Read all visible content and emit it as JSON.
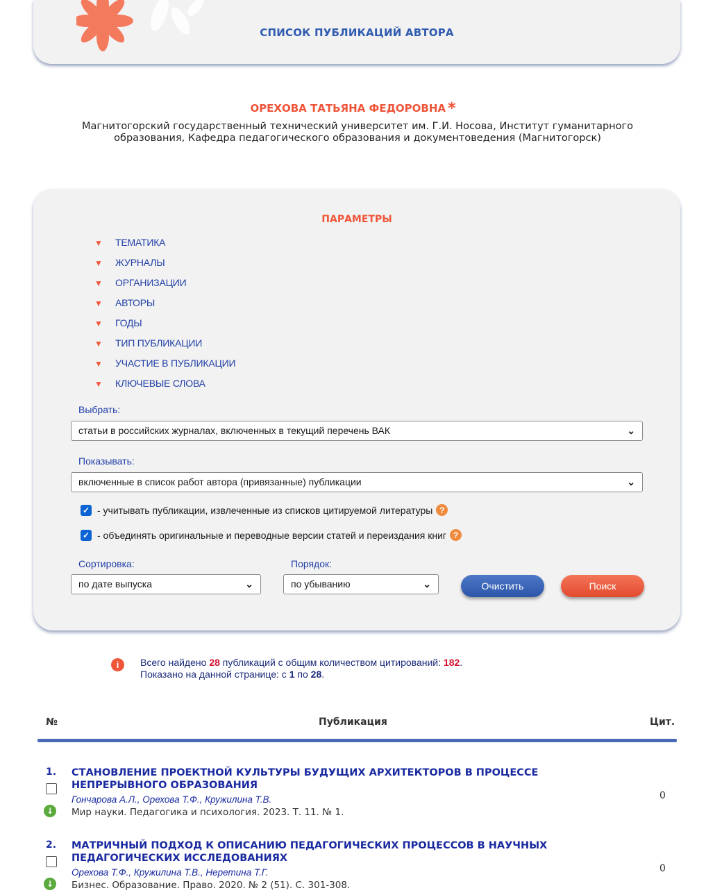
{
  "header": {
    "title": "СПИСОК ПУБЛИКАЦИЙ АВТОРА"
  },
  "author": {
    "name": "ОРЕХОВА ТАТЬЯНА ФЕДОРОВНА",
    "star": "*",
    "affiliation": "Магнитогорский государственный технический университет им. Г.И. Носова, Институт гуманитарного образования, Кафедра педагогического образования и документоведения (Магнитогорск)"
  },
  "params": {
    "title": "ПАРАМЕТРЫ",
    "filters": [
      "ТЕМАТИКА",
      "ЖУРНАЛЫ",
      "ОРГАНИЗАЦИИ",
      "АВТОРЫ",
      "ГОДЫ",
      "ТИП ПУБЛИКАЦИИ",
      "УЧАСТИЕ В ПУБЛИКАЦИИ",
      "КЛЮЧЕВЫЕ СЛОВА"
    ],
    "select_label": "Выбрать:",
    "select_value": "статьи в российских журналах, включенных в текущий перечень ВАК",
    "show_label": "Показывать:",
    "show_value": "включенные в список работ автора (привязанные) публикации",
    "checkbox1": "- учитывать публикации, извлеченные из списков цитируемой литературы",
    "checkbox2": "- объединять оригинальные и переводные версии статей и переиздания книг",
    "sort_label": "Сортировка:",
    "sort_value": "по дате выпуска",
    "order_label": "Порядок:",
    "order_value": "по убыванию",
    "clear_button": "Очистить",
    "search_button": "Поиск"
  },
  "summary": {
    "line1_a": "Всего найдено ",
    "total": "28",
    "line1_b": " публикаций с общим количеством цитирований: ",
    "citations": "182",
    "line1_c": ".",
    "line2_a": "Показано на данной странице: с ",
    "from": "1",
    "line2_b": " по ",
    "to": "28",
    "line2_c": "."
  },
  "table": {
    "col_num": "№",
    "col_pub": "Публикация",
    "col_cit": "Цит.",
    "rows": [
      {
        "num": "1.",
        "title": "СТАНОВЛЕНИЕ ПРОЕКТНОЙ КУЛЬТУРЫ БУДУЩИХ АРХИТЕКТОРОВ В ПРОЦЕССЕ НЕПРЕРЫВНОГО ОБРАЗОВАНИЯ",
        "authors": "Гончарова А.Л., Орехова Т.Ф., Кружилина Т.В.",
        "source": "Мир науки. Педагогика и психология. 2023. Т. 11. № 1.",
        "cit": "0"
      },
      {
        "num": "2.",
        "title": "МАТРИЧНЫЙ ПОДХОД К ОПИСАНИЮ ПЕДАГОГИЧЕСКИХ ПРОЦЕССОВ В НАУЧНЫХ ПЕДАГОГИЧЕСКИХ ИССЛЕДОВАНИЯХ",
        "authors": "Орехова Т.Ф., Кружилина Т.В., Неретина Т.Г.",
        "source": "Бизнес. Образование. Право. 2020. № 2 (51). С. 301-308.",
        "cit": "0"
      }
    ]
  },
  "colors": {
    "accent": "#f0553a",
    "link": "#1a2aa0",
    "primary": "#2f5bb0"
  }
}
